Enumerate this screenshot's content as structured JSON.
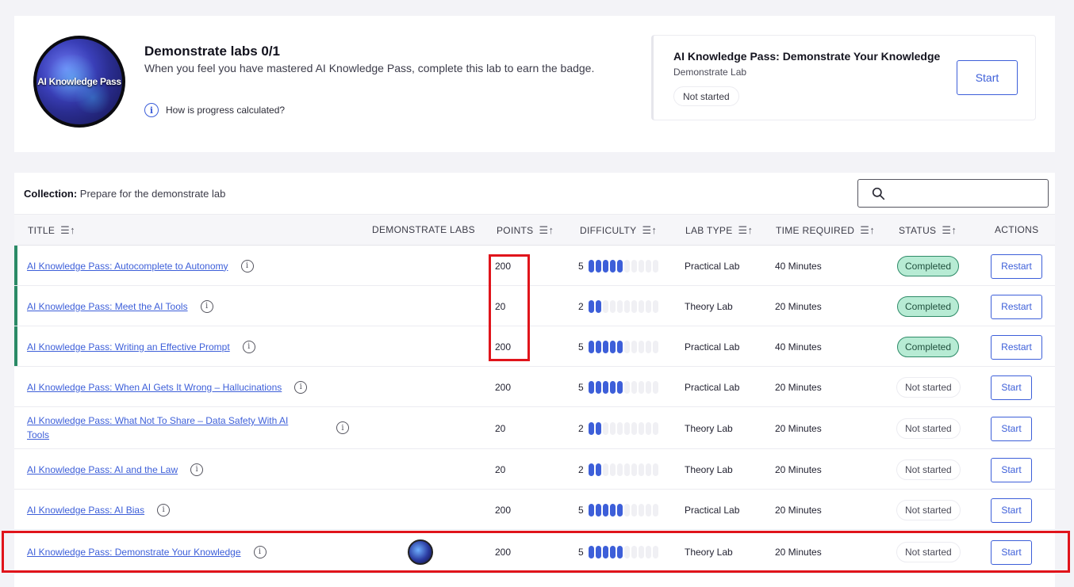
{
  "badge": {
    "text": "AI Knowledge Pass"
  },
  "demo": {
    "title": "Demonstrate labs 0/1",
    "description": "When you feel you have mastered AI Knowledge Pass, complete this lab to earn the badge.",
    "help_link": "How is progress calculated?"
  },
  "demo_panel": {
    "title": "AI Knowledge Pass: Demonstrate Your Knowledge",
    "subtitle": "Demonstrate Lab",
    "status": "Not started",
    "start_label": "Start"
  },
  "collection": {
    "label": "Collection:",
    "name": "Prepare for the demonstrate lab"
  },
  "columns": {
    "title": "TITLE",
    "demo_labs": "DEMONSTRATE LABS",
    "points": "POINTS",
    "difficulty": "DIFFICULTY",
    "lab_type": "LAB TYPE",
    "time": "TIME REQUIRED",
    "status": "STATUS",
    "actions": "ACTIONS"
  },
  "rows": [
    {
      "title": "AI Knowledge Pass: Autocomplete to Autonomy",
      "points": "200",
      "difficulty": "5",
      "difficulty_level": 5,
      "lab_type": "Practical Lab",
      "time": "40 Minutes",
      "status": "Completed",
      "action": "Restart"
    },
    {
      "title": "AI Knowledge Pass: Meet the AI Tools",
      "points": "20",
      "difficulty": "2",
      "difficulty_level": 2,
      "lab_type": "Theory Lab",
      "time": "20 Minutes",
      "status": "Completed",
      "action": "Restart"
    },
    {
      "title": "AI Knowledge Pass: Writing an Effective Prompt",
      "points": "200",
      "difficulty": "5",
      "difficulty_level": 5,
      "lab_type": "Practical Lab",
      "time": "40 Minutes",
      "status": "Completed",
      "action": "Restart"
    },
    {
      "title": "AI Knowledge Pass: When AI Gets It Wrong – Hallucinations",
      "points": "200",
      "difficulty": "5",
      "difficulty_level": 5,
      "lab_type": "Practical Lab",
      "time": "20 Minutes",
      "status": "Not started",
      "action": "Start"
    },
    {
      "title": "AI Knowledge Pass: What Not To Share – Data Safety With AI Tools",
      "points": "20",
      "difficulty": "2",
      "difficulty_level": 2,
      "lab_type": "Theory Lab",
      "time": "20 Minutes",
      "status": "Not started",
      "action": "Start"
    },
    {
      "title": "AI Knowledge Pass: AI and the Law",
      "points": "20",
      "difficulty": "2",
      "difficulty_level": 2,
      "lab_type": "Theory Lab",
      "time": "20 Minutes",
      "status": "Not started",
      "action": "Start"
    },
    {
      "title": "AI Knowledge Pass: AI Bias",
      "points": "200",
      "difficulty": "5",
      "difficulty_level": 5,
      "lab_type": "Practical Lab",
      "time": "20 Minutes",
      "status": "Not started",
      "action": "Start"
    },
    {
      "title": "AI Knowledge Pass: Demonstrate Your Knowledge",
      "points": "200",
      "difficulty": "5",
      "difficulty_level": 5,
      "lab_type": "Theory Lab",
      "time": "20 Minutes",
      "status": "Not started",
      "action": "Start",
      "has_badge": true
    }
  ],
  "colors": {
    "accent": "#3d5fd9",
    "completed_bg": "#b7ebd4",
    "completed_border": "#2e8a67",
    "highlight": "#e0141b"
  }
}
